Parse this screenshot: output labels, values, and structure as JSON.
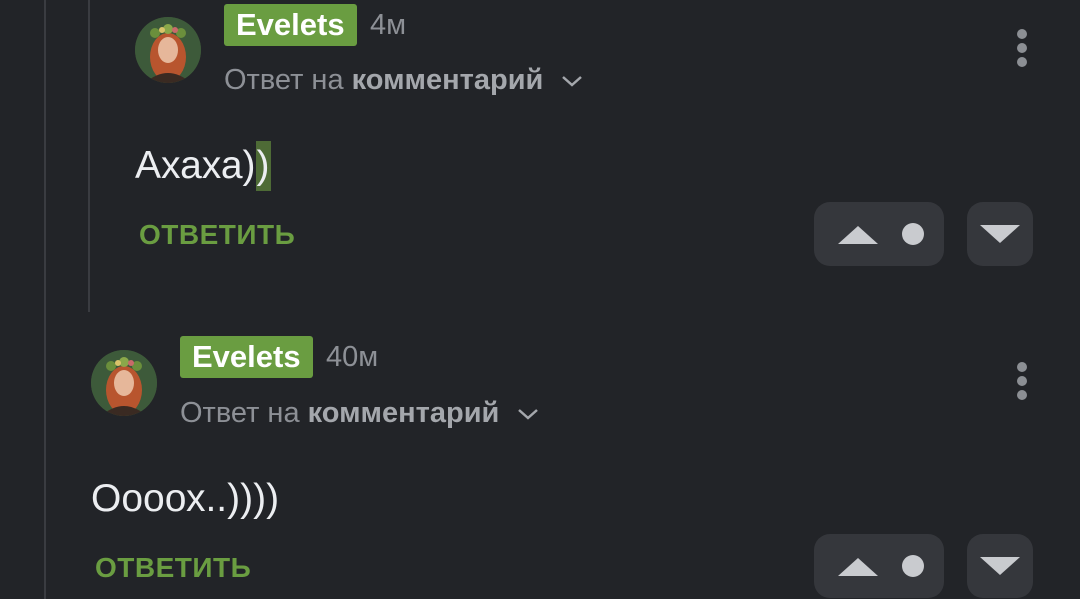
{
  "comments": [
    {
      "author": "Evelets",
      "time": "4м",
      "reply_prefix": "Ответ на",
      "reply_target": "комментарий",
      "text_main": "Ахаха)",
      "text_highlight": ")",
      "reply_label": "ОТВЕТИТЬ",
      "avatar_icon": "avatar-woman-flower-crown"
    },
    {
      "author": "Evelets",
      "time": "40м",
      "reply_prefix": "Ответ на",
      "reply_target": "комментарий",
      "text_main": "Оооох..))))",
      "reply_label": "ОТВЕТИТЬ",
      "avatar_icon": "avatar-woman-flower-crown"
    }
  ],
  "colors": {
    "background": "#222428",
    "accent_green": "#6a9d41",
    "vote_box": "#35373c",
    "muted_text": "#8d9096"
  },
  "icons": [
    "more-vertical-icon",
    "chevron-down-icon",
    "upvote-icon",
    "rating-dot-icon",
    "downvote-icon"
  ]
}
